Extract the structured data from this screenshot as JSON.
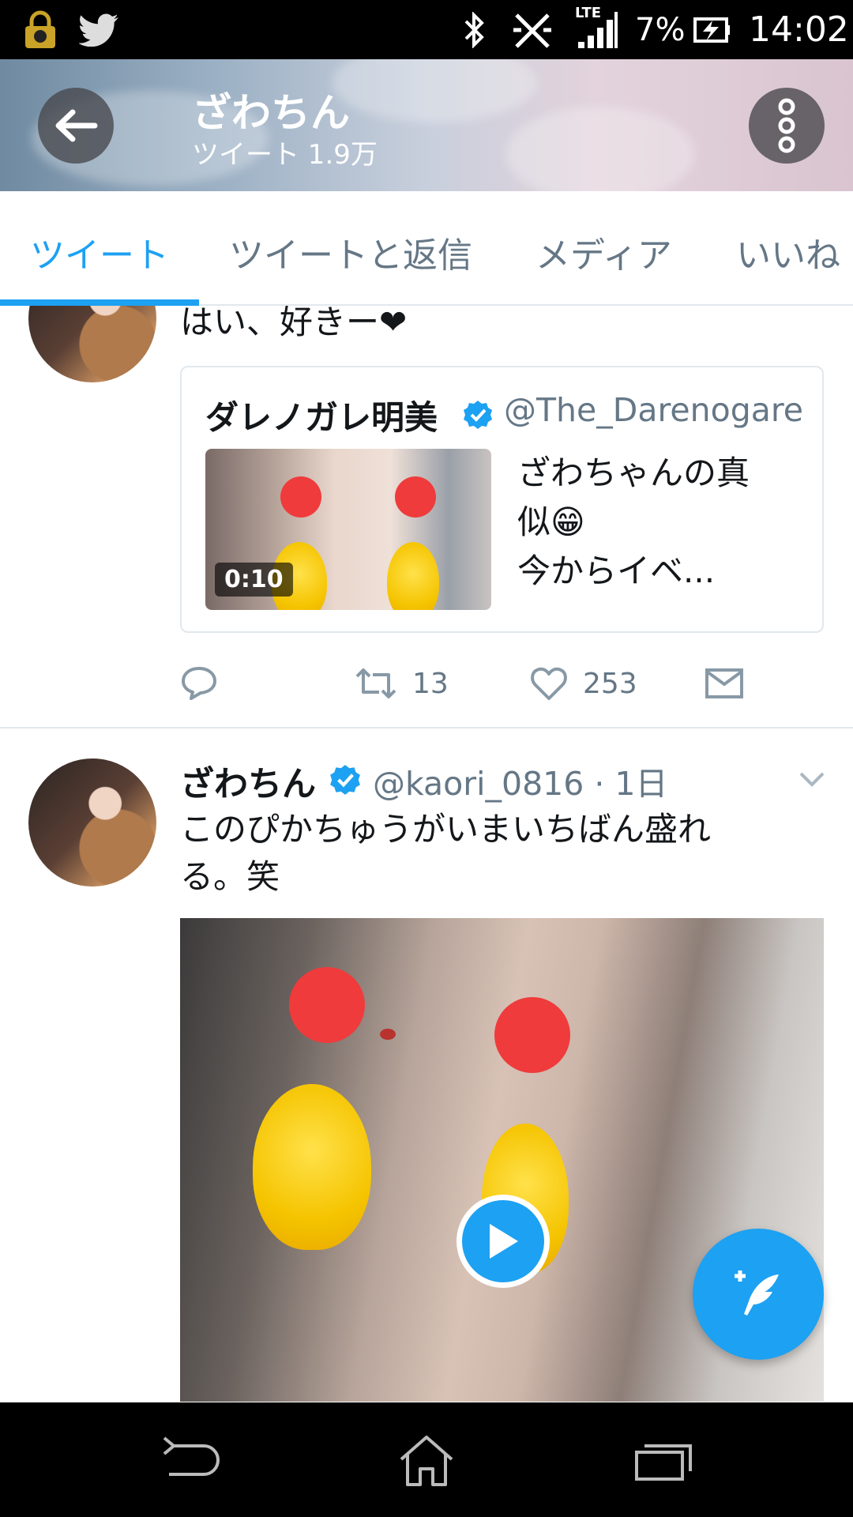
{
  "status_bar": {
    "network": "LTE",
    "battery": "7%",
    "time": "14:02"
  },
  "header": {
    "name": "ざわちん",
    "tweet_count": "ツイート 1.9万"
  },
  "tabs": [
    {
      "label": "ツイート",
      "active": true
    },
    {
      "label": "ツイートと返信",
      "active": false
    },
    {
      "label": "メディア",
      "active": false
    },
    {
      "label": "いいね",
      "active": false
    }
  ],
  "tweet1": {
    "text": "はい、好きー❤",
    "quote": {
      "name": "ダレノガレ明美",
      "handle": "@The_Darenogare",
      "duration": "0:10",
      "text_line1": "ざわちゃんの真",
      "text_line2": "似😁",
      "text_line3": "今からイベ..."
    },
    "retweets": "13",
    "likes": "253"
  },
  "tweet2": {
    "name": "ざわちん",
    "handle_time": "@kaori_0816 · 1日",
    "text_line1": "このぴかちゅうがいまいちばん盛れ",
    "text_line2": "る。笑"
  },
  "colors": {
    "accent": "#1da1f2",
    "secondary_text": "#657786",
    "border": "#e1e8ed"
  }
}
